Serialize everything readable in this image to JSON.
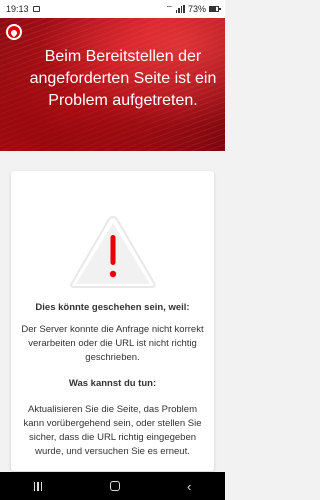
{
  "status_bar": {
    "time": "19:13",
    "battery": "73%",
    "battery_level": 0.73,
    "icons": [
      "image-icon",
      "wifi-icon",
      "signal-icon",
      "battery-icon"
    ]
  },
  "hero": {
    "logo": "vodafone-logo",
    "title": "Beim Bereitstellen der angeforderten Seite ist ein Problem aufgetreten.",
    "colors": {
      "primary": "#e60000",
      "dark": "#7a070c"
    }
  },
  "card": {
    "icon": "warning-triangle-icon",
    "icon_color": "#e60000",
    "heading_reasons": "Dies könnte geschehen sein, weil:",
    "reason_text": "Der Server konnte die Anfrage nicht korrekt verarbeiten oder die URL ist nicht richtig geschrieben.",
    "heading_action": "Was kannst du tun:",
    "action_text": "Aktualisieren Sie die Seite, das Problem kann vorübergehend sein, oder stellen Sie sicher, dass die URL richtig eingegeben wurde, und versuchen Sie es erneut."
  },
  "nav_bar": {
    "buttons": [
      "recents-icon",
      "home-icon",
      "back-icon"
    ]
  }
}
